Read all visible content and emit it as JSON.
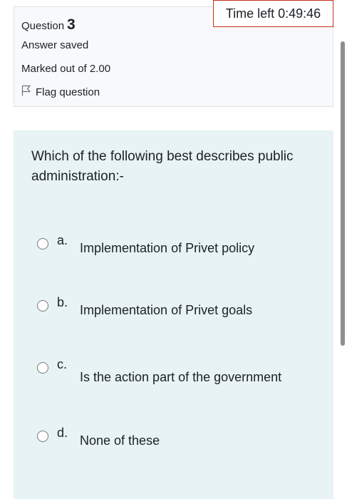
{
  "info": {
    "question_label": "Question",
    "question_number": "3",
    "state": "Answer saved",
    "marked_out_of": "Marked out of 2.00",
    "flag_label": "Flag question"
  },
  "timer": {
    "text": "Time left 0:49:46"
  },
  "question": {
    "text": "Which of the following best describes public administration:-",
    "options": [
      {
        "letter": "a.",
        "text": "Implementation of Privet  policy"
      },
      {
        "letter": "b.",
        "text": "Implementation of Privet  goals"
      },
      {
        "letter": "c.",
        "text": "Is the action part of the government"
      },
      {
        "letter": "d.",
        "text": "None of these"
      }
    ]
  },
  "colors": {
    "timer_border": "#ca3120",
    "question_bg": "#e7f3f5",
    "info_bg": "#f8f9fa"
  }
}
